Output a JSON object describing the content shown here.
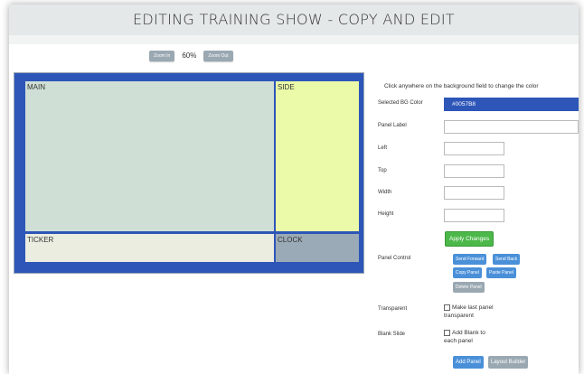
{
  "header": {
    "title": "EDITING TRAINING SHOW - COPY AND EDIT"
  },
  "zoom": {
    "zoom_in_label": "Zoom In",
    "level": "60%",
    "zoom_out_label": "Zoom Out"
  },
  "canvas": {
    "bg_color": "#0057B8",
    "panels": [
      {
        "label": "MAIN"
      },
      {
        "label": "SIDE"
      },
      {
        "label": "TICKER"
      },
      {
        "label": "CLOCK"
      }
    ]
  },
  "form": {
    "hint": "Click anywhere on the background field to change the color",
    "selected_bg_label": "Selected BG Color",
    "selected_bg_value": "#0057B8",
    "panel_label_label": "Panel Label",
    "panel_label_value": "",
    "left_label": "Left",
    "top_label": "Top",
    "width_label": "Width",
    "height_label": "Height",
    "apply_label": "Apply Changes",
    "panel_control_label": "Panel Control",
    "send_forward": "Send Forward",
    "send_back": "Send Back",
    "copy_panel": "Copy Panel",
    "paste_panel": "Paste Panel",
    "delete_panel": "Delete Panel",
    "transparent_label": "Transparent",
    "transparent_text_1": "Make last panel",
    "transparent_text_2": "transparent",
    "blank_slide_label": "Blank Slide",
    "blank_text_1": "Add Blank to",
    "blank_text_2": "each panel",
    "add_panel": "Add Panel",
    "layout_builder": "Layout Builder"
  },
  "colors": {
    "accent": "#2d56b8",
    "green": "#4cb84a",
    "blue_button": "#4a90d9"
  }
}
